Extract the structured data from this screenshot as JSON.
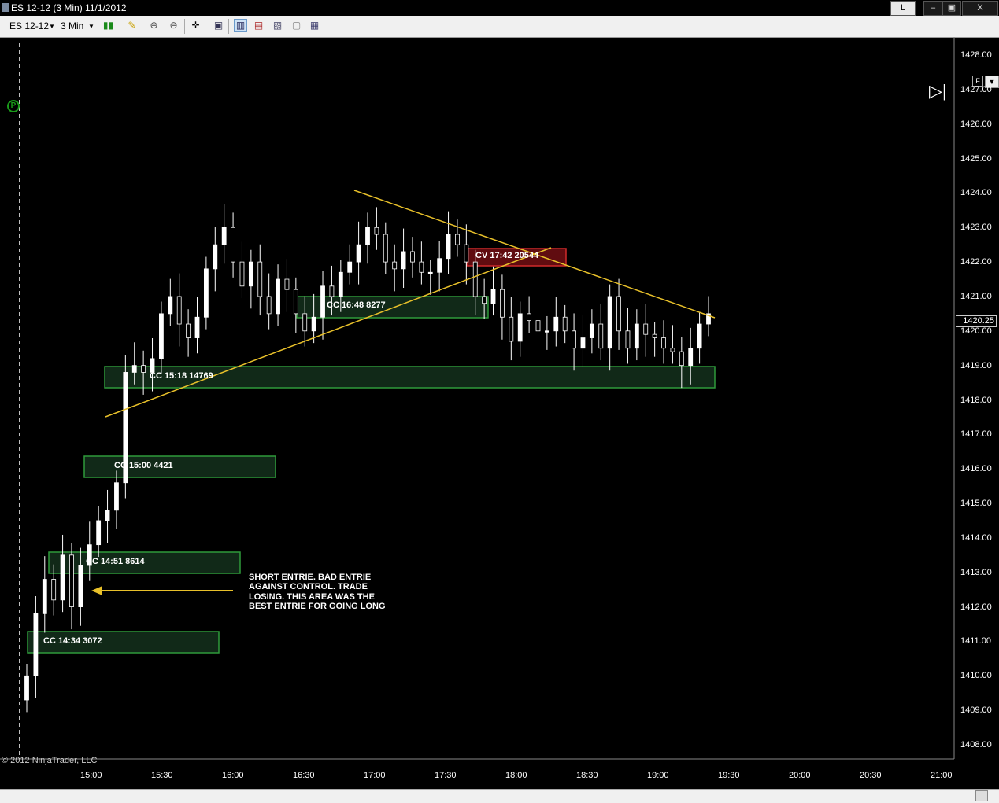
{
  "window": {
    "title": "ES 12-12 (3 Min)  11/1/2012",
    "min_label": "L",
    "restore_label": "▭",
    "maximize_label": "▣",
    "close_label": "X"
  },
  "toolbar": {
    "instrument": "ES 12-12",
    "interval": "3 Min",
    "icons": [
      "candlestick-icon",
      "pencil-icon",
      "zoom-in-icon",
      "zoom-out-icon",
      "crosshair-icon",
      "data-box-icon",
      "bar-type-icon",
      "chart-style-icon",
      "chart-properties-icon",
      "tile-icon",
      "window-link-icon"
    ]
  },
  "chart": {
    "copyright": "© 2012 NinjaTrader, LLC",
    "current_price": "1420.25",
    "f_button": "F",
    "y_labels": [
      "1428.00",
      "1427.00",
      "1426.00",
      "1425.00",
      "1424.00",
      "1423.00",
      "1422.00",
      "1421.00",
      "1420.00",
      "1419.00",
      "1418.00",
      "1417.00",
      "1416.00",
      "1415.00",
      "1414.00",
      "1413.00",
      "1412.00",
      "1411.00",
      "1410.00",
      "1409.00",
      "1408.00"
    ],
    "x_labels": [
      "15:00",
      "15:30",
      "16:00",
      "16:30",
      "17:00",
      "17:30",
      "18:00",
      "18:30",
      "19:00",
      "19:30",
      "20:00",
      "20:30",
      "21:00"
    ],
    "boxes": [
      {
        "label": "CC 14:34 3072",
        "kind": "cc"
      },
      {
        "label": "CC 14:51 8614",
        "kind": "cc"
      },
      {
        "label": "CC 15:00 4421",
        "kind": "cc"
      },
      {
        "label": "CC 15:18 14769",
        "kind": "cc"
      },
      {
        "label": "CC 16:48 8277",
        "kind": "cc"
      },
      {
        "label": "CV 17:42 20544",
        "kind": "cv"
      }
    ],
    "annotation": "SHORT ENTRIE. BAD ENTRIE AGAINST CONTROL. TRADE LOSING. THIS AREA WAS THE BEST ENTRIE FOR GOING LONG",
    "colors": {
      "background": "#000000",
      "cc_fill": "#14301c",
      "cc_border": "#2f9a3a",
      "cv_fill": "#6a0d12",
      "cv_border": "#d02a2a",
      "trendline": "#e8c02a",
      "bull_candle": "#ffffff",
      "bear_candle": "#000000"
    }
  },
  "chart_data": {
    "type": "candlestick",
    "title": "ES 12-12 (3 Min)  11/1/2012",
    "y_range": [
      1407.5,
      1428.3
    ],
    "x_range": [
      "14:30",
      "21:00"
    ],
    "closes_approx": [
      1410.0,
      1411.8,
      1412.8,
      1412.2,
      1413.5,
      1412.0,
      1413.2,
      1413.8,
      1414.5,
      1414.8,
      1415.6,
      1418.8,
      1419.0,
      1418.8,
      1419.2,
      1420.5,
      1421.0,
      1420.2,
      1419.8,
      1420.4,
      1421.8,
      1422.5,
      1423.0,
      1422.0,
      1421.3,
      1422.0,
      1421.0,
      1420.5,
      1421.5,
      1421.2,
      1420.5,
      1420.0,
      1420.4,
      1421.3,
      1421.0,
      1421.7,
      1422.0,
      1422.5,
      1423.0,
      1422.8,
      1422.0,
      1421.8,
      1422.3,
      1422.0,
      1421.7,
      1421.7,
      1422.1,
      1422.8,
      1422.5,
      1422.0,
      1421.0,
      1420.8,
      1421.2,
      1420.4,
      1419.7,
      1420.5,
      1420.3,
      1420.0,
      1420.0,
      1420.4,
      1420.0,
      1419.5,
      1419.8,
      1420.2,
      1419.5,
      1421.0,
      1420.0,
      1419.5,
      1420.2,
      1419.9,
      1419.8,
      1419.5,
      1419.4,
      1419.0,
      1419.5,
      1420.2,
      1420.5
    ]
  }
}
